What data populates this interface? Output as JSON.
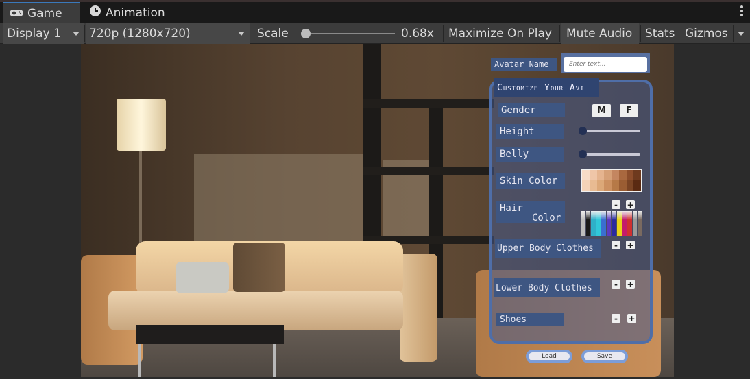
{
  "tabs": [
    {
      "label": "Game",
      "icon": "gamepad-icon"
    },
    {
      "label": "Animation",
      "icon": "animation-clock-icon"
    }
  ],
  "toolbar": {
    "display": "Display 1",
    "resolution": "720p (1280x720)",
    "scale_label": "Scale",
    "scale_value": "0.68x",
    "scale_fraction": 0.02,
    "maximize": "Maximize On Play",
    "mute": "Mute Audio",
    "stats": "Stats",
    "gizmos": "Gizmos"
  },
  "ui": {
    "avatar_name_label": "Avatar Name",
    "avatar_name_placeholder": "Enter text...",
    "title": "Customize Your Avi",
    "gender_label": "Gender",
    "gender_m": "M",
    "gender_f": "F",
    "height_label": "Height",
    "height_value": 0.0,
    "belly_label": "Belly",
    "belly_value": 0.0,
    "skin_label": "Skin Color",
    "skin_colors": [
      "#f7dcc7",
      "#efc6a8",
      "#e5b48f",
      "#d6a077",
      "#c48660",
      "#a9683f",
      "#8c4d2b",
      "#6e3a1e",
      "#f4d3b8",
      "#e8bb92",
      "#dca878",
      "#cc9060",
      "#b67947",
      "#9a5d33",
      "#7a4424",
      "#5a2a12"
    ],
    "hair_label_1": "Hair",
    "hair_label_2": "Color",
    "hair_colors": [
      "#bdbdbd",
      "#1a1a1a",
      "#2fb0c8",
      "#31c7d8",
      "#3a6fd0",
      "#5b3bc0",
      "#2a2aa0",
      "#e8d21a",
      "#c41c6a",
      "#d03030",
      "#9a9a9a",
      "#7a6a60"
    ],
    "upper_label": "Upper Body Clothes",
    "lower_label": "Lower Body Clothes",
    "shoes_label": "Shoes",
    "minus": "-",
    "plus": "+",
    "load": "Load",
    "save": "Save"
  }
}
